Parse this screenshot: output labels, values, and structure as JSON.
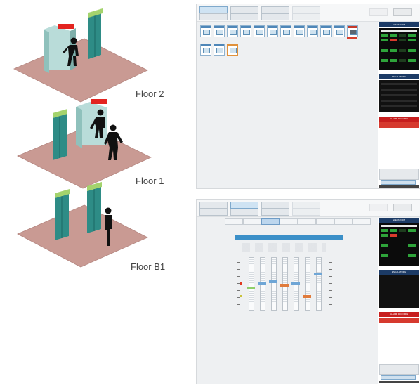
{
  "floors": [
    {
      "id": "floor-2",
      "label": "Floor 2"
    },
    {
      "id": "floor-1",
      "label": "Floor 1"
    },
    {
      "id": "floor-b1",
      "label": "Floor B1"
    }
  ],
  "colors": {
    "floor_plane": "#c99a93",
    "floor_plane_edge": "#a57b75",
    "door": "#2e8c86",
    "door_dark": "#1f6f6a",
    "door_light_green": "#a4d36d",
    "door_light_red": "#e32420",
    "cabin": "#b9dcd9",
    "cabin_side": "#8fc1bc",
    "person": "#111111",
    "panel_header": "#1c3b66",
    "alarm_header": "#c71e1e",
    "active_tab": "#bcd6ee"
  },
  "screen_top": {
    "toolbar_right": {
      "btn_a": "HOME",
      "btn_b": "LOG"
    },
    "panel_headers": {
      "status": "ELEVATORS",
      "escalators": "ESCALATORS",
      "alarms": "ALARM RECORDS"
    }
  },
  "screen_bottom": {
    "selected_car_label": "Elev 2"
  }
}
